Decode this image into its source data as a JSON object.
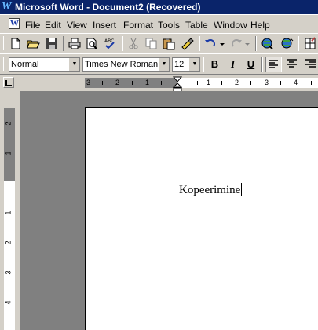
{
  "window": {
    "title": "Microsoft Word - Document2 (Recovered)"
  },
  "menu": {
    "items": [
      {
        "label": "File"
      },
      {
        "label": "Edit"
      },
      {
        "label": "View"
      },
      {
        "label": "Insert"
      },
      {
        "label": "Format"
      },
      {
        "label": "Tools"
      },
      {
        "label": "Table"
      },
      {
        "label": "Window"
      },
      {
        "label": "Help"
      }
    ]
  },
  "formatting": {
    "style": "Normal",
    "font": "Times New Roman",
    "size": "12",
    "bold_label": "B",
    "italic_label": "I",
    "underline_label": "U",
    "alignment": "left"
  },
  "ruler": {
    "labels": [
      "3",
      "2",
      "1",
      "1",
      "2",
      "3",
      "4"
    ]
  },
  "vruler": {
    "labels": [
      "2",
      "1",
      "1",
      "2",
      "3",
      "4"
    ]
  },
  "document": {
    "text": "Kopeerimine"
  },
  "colors": {
    "title_bar": "#0a246a",
    "chrome": "#d4d0c8",
    "workspace": "#808080"
  }
}
